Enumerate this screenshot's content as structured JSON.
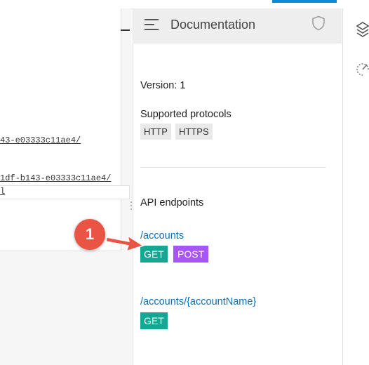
{
  "left_panel": {
    "path1": "43-e03333c11ae4/",
    "path2": "1df-b143-e03333c11ae4/",
    "input_value": "l"
  },
  "doc": {
    "title": "Documentation",
    "version": "Version: 1",
    "protocols_label": "Supported protocols",
    "protocols": [
      "HTTP",
      "HTTPS"
    ],
    "endpoints_label": "API endpoints",
    "endpoints": [
      {
        "path": "/accounts",
        "methods": [
          "GET",
          "POST"
        ]
      },
      {
        "path": "/accounts/{accountName}",
        "methods": [
          "GET"
        ]
      }
    ]
  },
  "annotation": {
    "number": "1"
  },
  "colors": {
    "get": "#13a893",
    "post": "#a855f7",
    "badge": "#ea5444",
    "link": "#0d6fb8"
  },
  "icons": [
    "menu-icon",
    "shield-icon",
    "stack-icon",
    "gauge-icon",
    "drag-handle-icon",
    "arrow-icon"
  ]
}
